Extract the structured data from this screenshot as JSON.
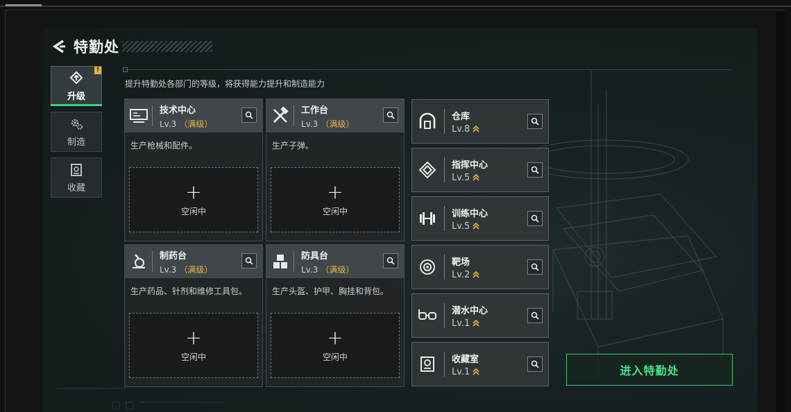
{
  "header": {
    "title": "特勤处"
  },
  "nav": {
    "items": [
      {
        "label": "升级",
        "icon": "upgrade-icon",
        "active": true,
        "badge": "!"
      },
      {
        "label": "制造",
        "icon": "gears-icon",
        "active": false
      },
      {
        "label": "收藏",
        "icon": "collection-icon",
        "active": false
      }
    ]
  },
  "description": "提升特勤处各部门的等级，将获得能力提升和制造能力",
  "facilities": [
    {
      "name": "技术中心",
      "level": "Lv.3",
      "max": "（满级）",
      "desc": "生产枪械和配件。",
      "slot": "空闲中",
      "plus": "+",
      "icon": "tech-center-icon"
    },
    {
      "name": "工作台",
      "level": "Lv.3",
      "max": "（满级）",
      "desc": "生产子弹。",
      "slot": "空闲中",
      "plus": "+",
      "icon": "workbench-icon"
    },
    {
      "name": "制药台",
      "level": "Lv.3",
      "max": "（满级）",
      "desc": "生产药品、针剂和维修工具包。",
      "slot": "空闲中",
      "plus": "+",
      "icon": "pharmacy-icon"
    },
    {
      "name": "防具台",
      "level": "Lv.3",
      "max": "（满级）",
      "desc": "生产头盔、护甲、胸挂和背包。",
      "slot": "空闲中",
      "plus": "+",
      "icon": "armor-bench-icon"
    }
  ],
  "rooms": [
    {
      "name": "仓库",
      "level": "Lv.8",
      "icon": "warehouse-icon"
    },
    {
      "name": "指挥中心",
      "level": "Lv.5",
      "icon": "command-center-icon"
    },
    {
      "name": "训练中心",
      "level": "Lv.5",
      "icon": "dumbbell-icon"
    },
    {
      "name": "靶场",
      "level": "Lv.2",
      "icon": "target-icon"
    },
    {
      "name": "潜水中心",
      "level": "Lv.1",
      "icon": "diving-goggles-icon"
    },
    {
      "name": "收藏室",
      "level": "Lv.1",
      "icon": "collection-room-icon"
    }
  ],
  "enter_button": "进入特勤处",
  "colors": {
    "accent_green": "#4fe38c",
    "max_gold": "#e4b64a",
    "badge_yellow": "#e3b53c"
  }
}
